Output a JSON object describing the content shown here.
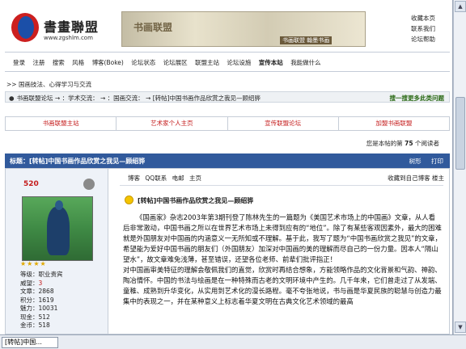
{
  "header": {
    "logo_name": "書畫聯盟",
    "logo_url": "www.zgshlm.com",
    "banner_title": "书画联盟",
    "banner_caption": "书画联盟 翰墨书画",
    "top_links": [
      "收藏本页",
      "联系我们",
      "论坛帮助"
    ]
  },
  "nav": {
    "items": [
      "登录",
      "注册",
      "搜索",
      "风格",
      "博客(Boke)",
      "论坛状态",
      "论坛展区",
      "联盟主站",
      "论坛设施",
      "宣传本站",
      "我能做什么"
    ],
    "bold_index": 9
  },
  "section_title": ">> 国画技法、心得学习与交流",
  "breadcrumb": {
    "text": "书画联盟论坛 → ：学术交流： → ：国画交流： → [转帖]中国书画作品欣赏之我见—顾绍骅",
    "search": "搜一搜更多此类问题"
  },
  "quick_links": [
    "书画联盟主站",
    "艺术家个人主页",
    "宣传联盟论坛",
    "加盟书画联盟"
  ],
  "readers": {
    "prefix": "您是本帖的第",
    "count": "75",
    "suffix": "个阅读者"
  },
  "topic": {
    "title": "标题：[转帖]中国书画作品欣赏之我见—顾绍骅",
    "actions": [
      "树形",
      "打印"
    ]
  },
  "user": {
    "id": "520",
    "stars": "★★★★",
    "stats": [
      {
        "label": "等级",
        "value": "职业贵宾"
      },
      {
        "label": "威望",
        "value": "3"
      },
      {
        "label": "文章",
        "value": "2868"
      },
      {
        "label": "积分",
        "value": "1619"
      },
      {
        "label": "魅力",
        "value": "10031"
      },
      {
        "label": "现金",
        "value": "512"
      },
      {
        "label": "金币",
        "value": "518"
      }
    ]
  },
  "post": {
    "toolbar": [
      "博客",
      "QQ联系",
      "电邮",
      "主页"
    ],
    "right": "收藏到自己博客 楼主",
    "subject": "[转帖]中国书画作品欣赏之我见—顾绍骅",
    "paragraphs": [
      "《国画家》杂志2003年第3期刊登了陈林先生的一篇题为《美国艺术市场上的中国画》文章，从人看后非常激动，中国书画之所以在世界艺术市场上未得到应有的“地位”。除了有某些客观因素外，最大的困难就是外国朋友对中国画的内涵意义一无所知或不理解。基于此，我写了题为“中国书画欣赏之我见”的文章，希望能为爱好中国书画的朋友们（外国朋友）加深对中国画的美的理解而尽自己的一份力量。因本人“隔山望水”，故文章难免浅薄，甚至错误，还望各位老师、前辈们批评指正！",
      "对中国画审美特征的理解会敬佩我们的直觉，欣赏时再结合想象，方能领略作品的文化背景和气韵、神韵、陶冶情怀。中国的书法与绘画是在一种特殊而古老的文明环境中产生的。几千年来，它们曾走过了从发端、童稚、成熟到升华变化，从实用到艺术化的漫长路程。毫不夸张地说，书与画是华夏民族的聪慧与创造力最集中的表现之一，并在某种意义上标志着华夏文明在古典文化艺术领域的最高"
    ]
  },
  "taskbar": {
    "label": "[转帖]中国..."
  },
  "colors": {
    "accent": "#315a9c",
    "link_red": "#c41b1b",
    "search_green": "#2b6a16"
  }
}
